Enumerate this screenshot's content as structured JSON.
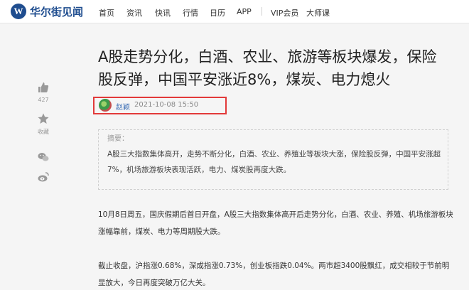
{
  "brand": {
    "logo_letter": "W",
    "name": "华尔街见闻",
    "color": "#1f4d8f"
  },
  "nav": {
    "items": [
      "首页",
      "资讯",
      "快讯",
      "行情",
      "日历",
      "APP"
    ],
    "extra": [
      "VIP会员",
      "大师课"
    ]
  },
  "article": {
    "title": "A股走势分化，白酒、农业、旅游等板块爆发，保险股反弹，中国平安涨近8%，煤炭、电力熄火",
    "author": "赵颖",
    "published": "2021-10-08 15:50",
    "summary_label": "摘要：",
    "summary": "A股三大指数集体高开，走势不断分化，白酒、农业、养殖业等板块大涨，保险股反弹，中国平安涨超7%，机场旅游板块表现活跃，电力、煤炭股再度大跌。",
    "paragraphs": [
      "10月8日周五，国庆假期后首日开盘，A股三大指数集体高开后走势分化，白酒、农业、养殖、机场旅游板块涨幅靠前，煤炭、电力等周期股大跌。",
      "截止收盘，沪指涨0.68%，深成指涨0.73%，创业板指跌0.04%。两市超3400股飘红，成交相较于节前明显放大，今日再度突破万亿大关。"
    ]
  },
  "side_actions": {
    "like_count": "427",
    "favorite_label": "收藏"
  },
  "colors": {
    "highlight": "#e23a3a",
    "link": "#3a6db5"
  }
}
